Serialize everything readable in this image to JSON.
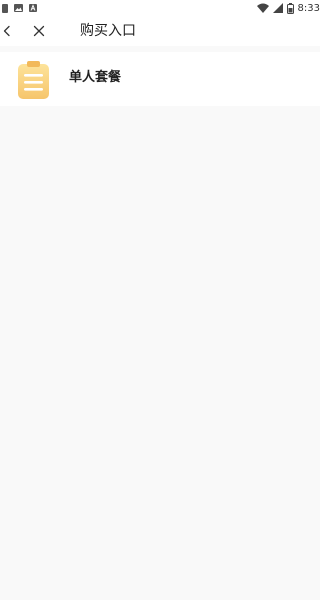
{
  "status_bar": {
    "time": "8:33",
    "icons": [
      "notification-icon",
      "image-icon",
      "text-a-icon",
      "wifi-icon",
      "signal-icon",
      "battery-icon"
    ]
  },
  "nav": {
    "title": "购买入口",
    "back_icon": "chevron-left-icon",
    "close_icon": "close-icon"
  },
  "list": {
    "items": [
      {
        "label": "单人套餐",
        "icon": "clipboard-icon"
      }
    ]
  },
  "colors": {
    "background": "#f9f9f9",
    "surface": "#ffffff",
    "icon_gradient_top": "#fde39a",
    "icon_gradient_bottom": "#f6c56c"
  }
}
